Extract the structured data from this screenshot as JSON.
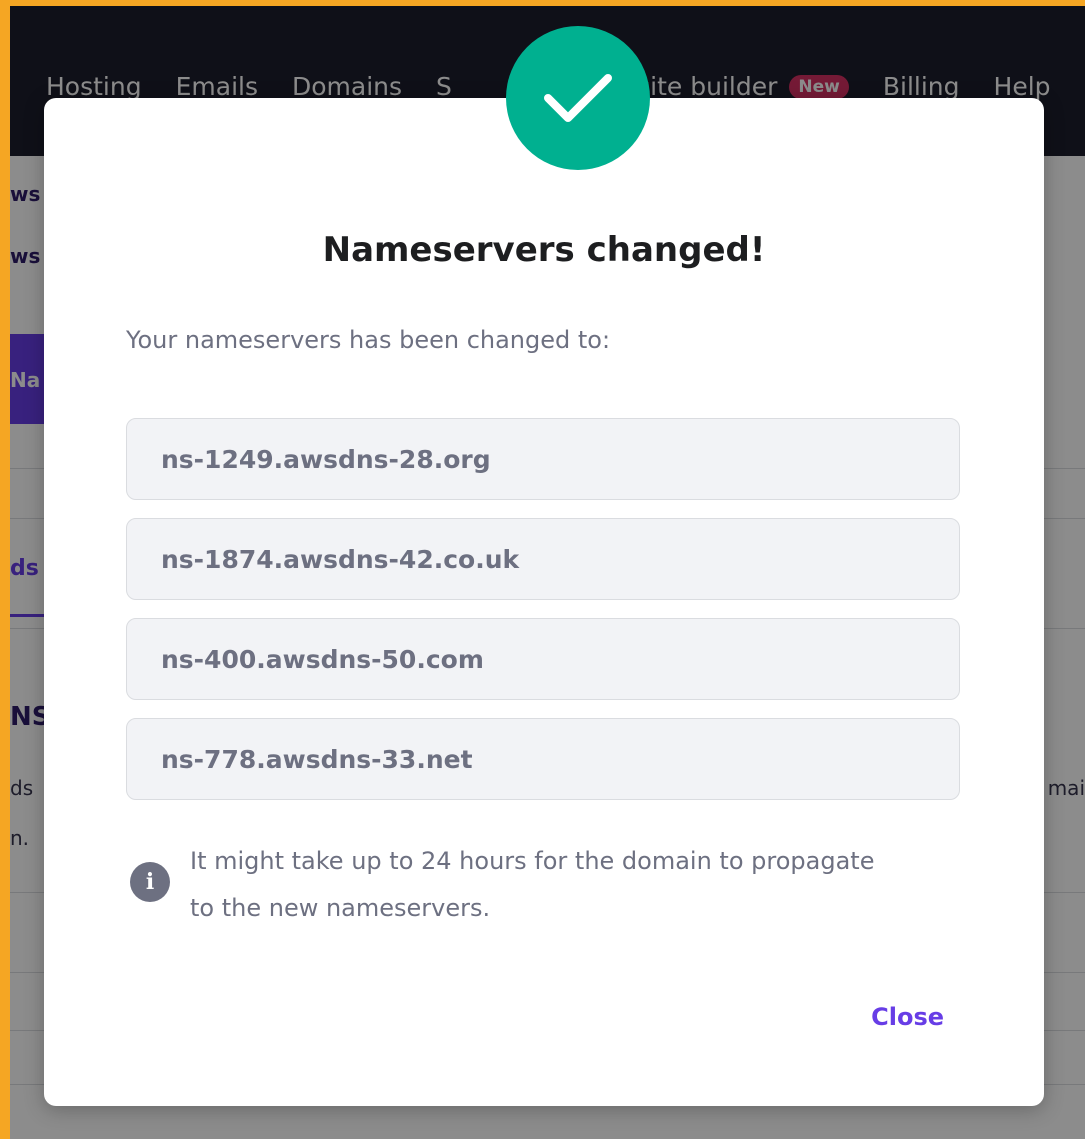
{
  "nav": {
    "items": [
      "Hosting",
      "Emails",
      "Domains",
      "S",
      "ebsite builder",
      "Billing",
      "Help"
    ],
    "badge": "New"
  },
  "background": {
    "sub_line_1": "ws",
    "sub_line_2": "ws",
    "purple_block_text": "Na",
    "tab_text": "ds",
    "section_heading": "NS",
    "body_frag_1": "ds",
    "body_frag_2": "n.",
    "body_frag_right": "mai"
  },
  "modal": {
    "icon": "checkmark-icon",
    "title": "Nameservers changed!",
    "subtitle": "Your nameservers has been changed to:",
    "nameservers": [
      "ns-1249.awsdns-28.org",
      "ns-1874.awsdns-42.co.uk",
      "ns-400.awsdns-50.com",
      "ns-778.awsdns-33.net"
    ],
    "info_icon": "info-icon",
    "info_line_1": "It might take up to 24 hours for the domain to propagate",
    "info_line_2": "to the new nameservers.",
    "close_label": "Close"
  },
  "colors": {
    "accent": "#673de6",
    "success": "#00b090",
    "badge": "#d63163",
    "frame": "#f5a623"
  }
}
